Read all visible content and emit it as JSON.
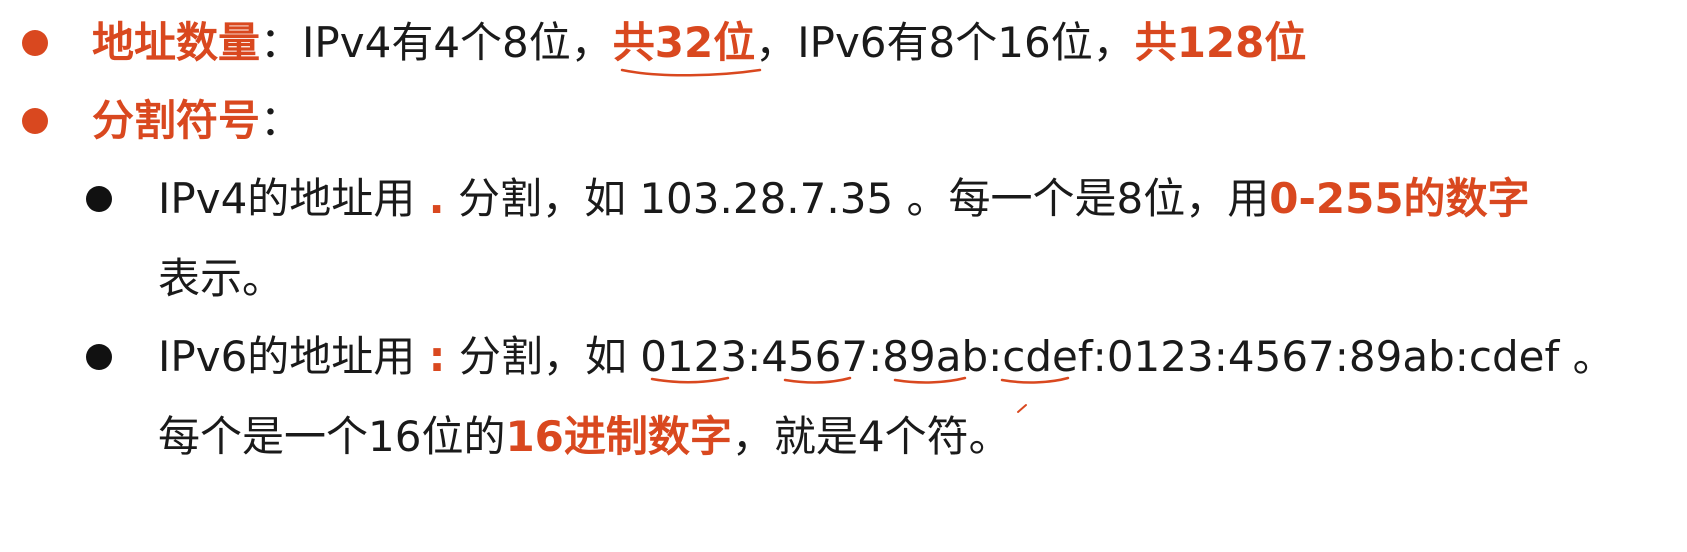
{
  "items": {
    "address_count": {
      "label": "地址数量",
      "colon": "：",
      "text1": "IPv4有4个8位，",
      "highlight1": "共32位",
      "text2": "，IPv6有8个16位，",
      "highlight2": "共128位"
    },
    "separator": {
      "label": "分割符号",
      "colon": "："
    },
    "ipv4": {
      "text1": "IPv4的地址用",
      "sep_char": ".",
      "text2": "分割，如 103.28.7.35 。每一个是8位，用",
      "highlight": "0-255的数字",
      "line2": "表示。"
    },
    "ipv6": {
      "text1": "IPv6的地址用",
      "sep_char": ":",
      "text2": "分割，如",
      "groups": [
        "0123",
        "4567",
        "89ab",
        "cdef",
        "0123",
        "4567",
        "89ab",
        "cdef"
      ],
      "text3": " 。",
      "line2a": "每个是一个16位的",
      "highlight": "16进制数字",
      "line2b": "，就是4个符。"
    }
  },
  "colors": {
    "accent": "#d9481f",
    "text": "#1a1a1a",
    "annotation": "#d9481f"
  }
}
